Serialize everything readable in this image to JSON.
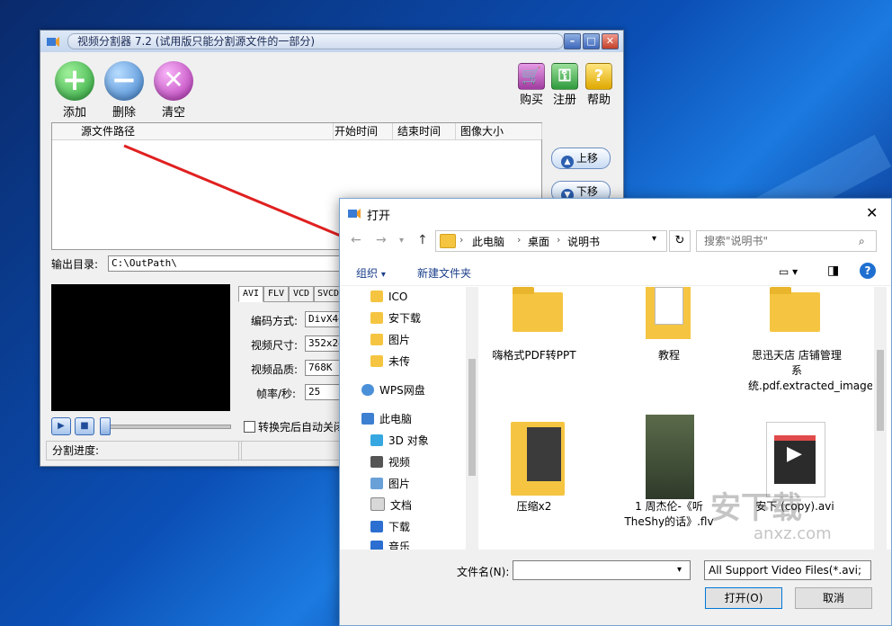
{
  "app": {
    "title": "视频分割器 7.2 (试用版只能分割源文件的一部分)",
    "toolbar": {
      "add": "添加",
      "delete": "删除",
      "clear": "清空",
      "buy": "购买",
      "register": "注册",
      "help": "帮助"
    },
    "columns": [
      "源文件路径",
      "开始时间",
      "结束时间",
      "图像大小"
    ],
    "move_up": "上移",
    "move_down": "下移",
    "output_label": "输出目录:",
    "output_path": "C:\\OutPath\\",
    "tabs": [
      "AVI",
      "FLV",
      "VCD",
      "SVCD"
    ],
    "fields": {
      "codec_label": "编码方式:",
      "codec_value": "DivX4+",
      "size_label": "视频尺寸:",
      "size_value": "352x24",
      "quality_label": "视频品质:",
      "quality_value": "768K",
      "fps_label": "帧率/秒:",
      "fps_value": "25"
    },
    "auto_close_label": "转换完后自动关闭",
    "progress_label": "分割进度:"
  },
  "dialog": {
    "title": "打开",
    "breadcrumb": [
      "此电脑",
      "桌面",
      "说明书"
    ],
    "search_placeholder": "搜索\"说明书\"",
    "organize": "组织",
    "new_folder": "新建文件夹",
    "nav_items": [
      "ICO",
      "安下载",
      "图片",
      "未传",
      "WPS网盘",
      "此电脑",
      "3D 对象",
      "视频",
      "图片",
      "文档",
      "下载",
      "音乐"
    ],
    "files": [
      {
        "name": "嗨格式PDF转PPT"
      },
      {
        "name": "教程"
      },
      {
        "name": "思迅天店 店铺管理系统.pdf.extracted_images"
      },
      {
        "name": "压缩x2"
      },
      {
        "name": "1 周杰伦-《听TheShy的话》.flv"
      },
      {
        "name": "安下 (copy).avi"
      }
    ],
    "filename_label": "文件名(N):",
    "filename_value": "",
    "filetype": "All Support Video Files(*.avi;",
    "open_button": "打开(O)",
    "cancel_button": "取消",
    "watermark": "安下载",
    "watermark_sub": "anxz.com"
  },
  "colors": {
    "add": "#3fb64a",
    "delete": "#4a90d8",
    "clear": "#c741c7",
    "arrow": "#e02020"
  }
}
